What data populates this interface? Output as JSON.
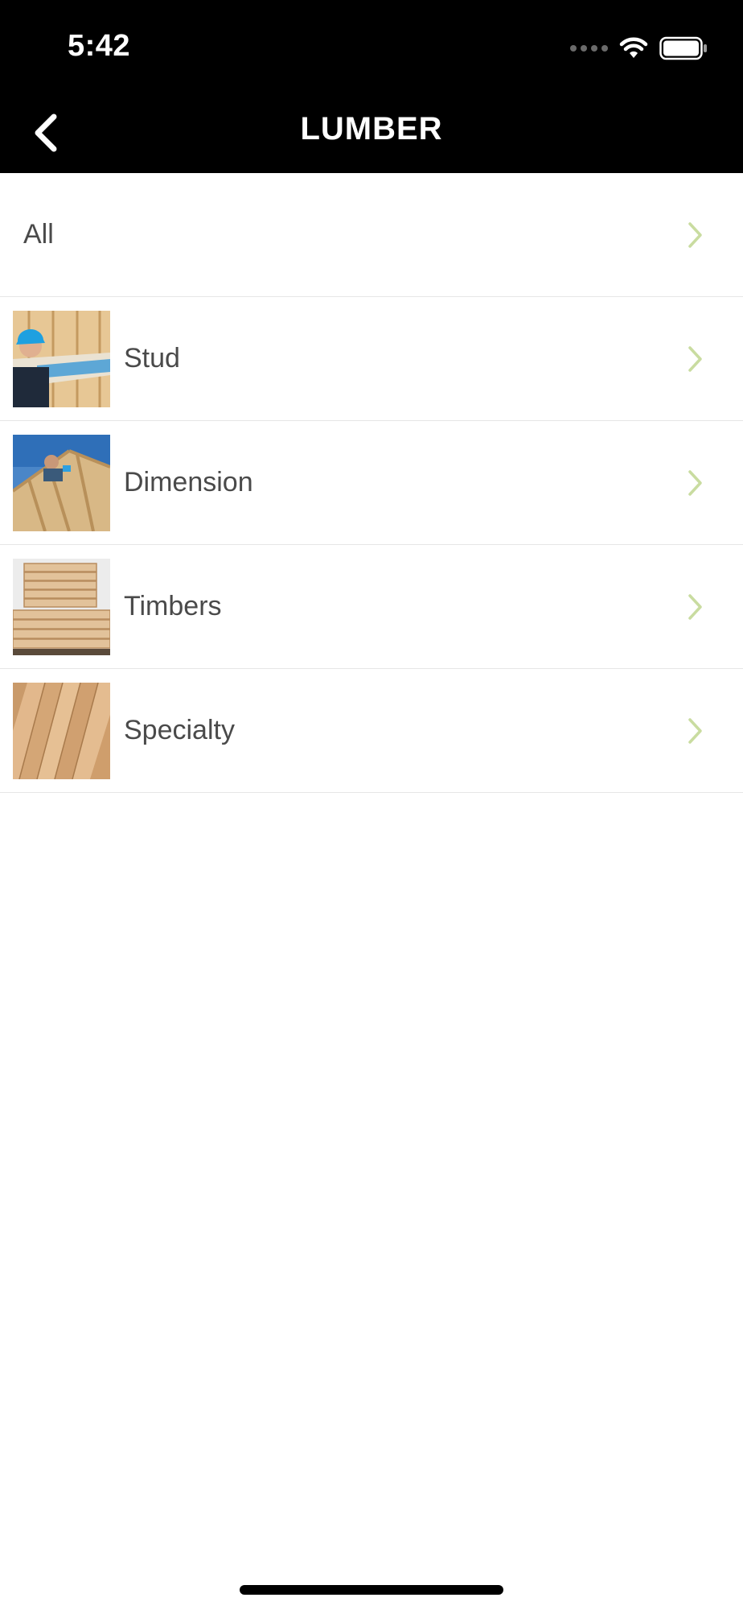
{
  "status_bar": {
    "time": "5:42"
  },
  "nav": {
    "title": "LUMBER",
    "back_icon": "chevron-left-icon"
  },
  "list": {
    "items": [
      {
        "label": "All",
        "thumbnail": null
      },
      {
        "label": "Stud",
        "thumbnail": "worker-carrying-lumber-photo"
      },
      {
        "label": "Dimension",
        "thumbnail": "roof-framing-photo"
      },
      {
        "label": "Timbers",
        "thumbnail": "stacked-timbers-photo"
      },
      {
        "label": "Specialty",
        "thumbnail": "wood-planks-photo"
      }
    ]
  },
  "colors": {
    "header_background": "#000000",
    "chevron": "#c9dca0",
    "row_text": "#4a4a4a",
    "divider": "#e6e6e6"
  }
}
